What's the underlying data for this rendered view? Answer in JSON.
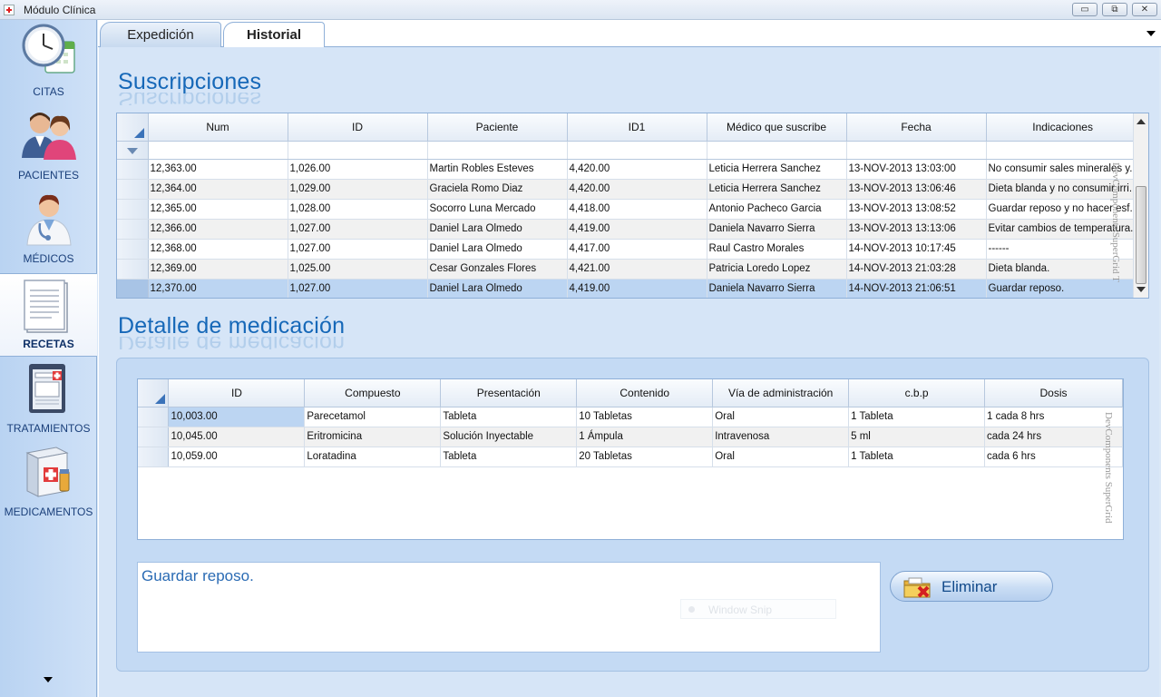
{
  "window": {
    "title": "Módulo Clínica",
    "controls": {
      "minimize": "▭",
      "restore": "⧉",
      "close": "✕"
    }
  },
  "sidebar": {
    "items": [
      {
        "label": "CITAS",
        "icon": "clock-calendar-icon"
      },
      {
        "label": "PACIENTES",
        "icon": "patients-icon"
      },
      {
        "label": "MÉDICOS",
        "icon": "doctor-icon"
      },
      {
        "label": "RECETAS",
        "icon": "prescription-document-icon",
        "active": true
      },
      {
        "label": "TRATAMIENTOS",
        "icon": "treatment-clipboard-icon"
      },
      {
        "label": "MEDICAMENTOS",
        "icon": "medicine-box-icon"
      }
    ]
  },
  "tabs": [
    {
      "label": "Expedición",
      "active": false
    },
    {
      "label": "Historial",
      "active": true
    }
  ],
  "subscriptions": {
    "title": "Suscripciones",
    "columns": [
      "Num",
      "ID",
      "Paciente",
      "ID1",
      "Médico que suscribe",
      "Fecha",
      "Indicaciones"
    ],
    "rows": [
      [
        "12,363.00",
        "1,026.00",
        "Martin Robles Esteves",
        "4,420.00",
        "Leticia Herrera Sanchez",
        "13-NOV-2013 13:03:00",
        "No consumir sales minerales y..."
      ],
      [
        "12,364.00",
        "1,029.00",
        "Graciela Romo Diaz",
        "4,420.00",
        "Leticia Herrera Sanchez",
        "13-NOV-2013 13:06:46",
        "Dieta blanda y no consumir irri..."
      ],
      [
        "12,365.00",
        "1,028.00",
        "Socorro Luna Mercado",
        "4,418.00",
        "Antonio Pacheco Garcia",
        "13-NOV-2013 13:08:52",
        "Guardar reposo y no hacer esf..."
      ],
      [
        "12,366.00",
        "1,027.00",
        "Daniel Lara Olmedo",
        "4,419.00",
        "Daniela Navarro Sierra",
        "13-NOV-2013 13:13:06",
        "Evitar cambios de temperatura..."
      ],
      [
        "12,368.00",
        "1,027.00",
        "Daniel Lara Olmedo",
        "4,417.00",
        "Raul Castro Morales",
        "14-NOV-2013 10:17:45",
        "------"
      ],
      [
        "12,369.00",
        "1,025.00",
        "Cesar Gonzales Flores",
        "4,421.00",
        "Patricia Loredo Lopez",
        "14-NOV-2013 21:03:28",
        "Dieta blanda."
      ],
      [
        "12,370.00",
        "1,027.00",
        "Daniel Lara Olmedo",
        "4,419.00",
        "Daniela Navarro Sierra",
        "14-NOV-2013 21:06:51",
        "Guardar reposo."
      ]
    ],
    "selected_row": 6,
    "watermark": "DevComponents SuperGrid T"
  },
  "medication": {
    "title": "Detalle de medicación",
    "columns": [
      "ID",
      "Compuesto",
      "Presentación",
      "Contenido",
      "Vía de administración",
      "c.b.p",
      "Dosis"
    ],
    "rows": [
      [
        "10,003.00",
        "Parecetamol",
        "Tableta",
        "10 Tabletas",
        "Oral",
        "1 Tableta",
        "1 cada 8 hrs"
      ],
      [
        "10,045.00",
        "Eritromicina",
        "Solución Inyectable",
        "1 Ámpula",
        "Intravenosa",
        "5 ml",
        "cada 24 hrs"
      ],
      [
        "10,059.00",
        "Loratadina",
        "Tableta",
        "20 Tabletas",
        "Oral",
        "1 Tableta",
        "cada 6 hrs"
      ]
    ],
    "watermark": "DevComponents SuperGrid"
  },
  "notes": {
    "text": "Guardar reposo."
  },
  "ghost_overlay": {
    "text": "Window Snip"
  },
  "actions": {
    "delete_label": "Eliminar",
    "delete_icon": "folder-delete-icon"
  },
  "colors": {
    "accent": "#1668b8",
    "selection": "#bcd5f2",
    "panel": "#d6e5f7"
  }
}
